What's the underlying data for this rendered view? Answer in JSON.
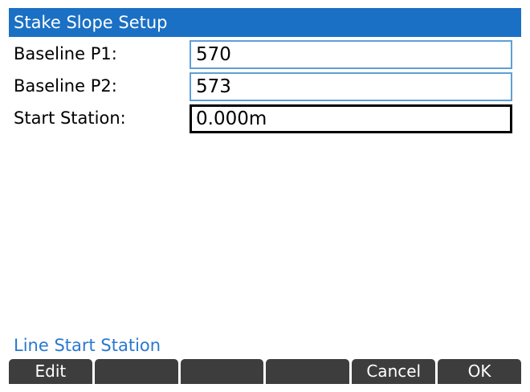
{
  "title": "Stake Slope Setup",
  "fields": [
    {
      "label": "Baseline P1:",
      "value": "570"
    },
    {
      "label": "Baseline P2:",
      "value": "573"
    },
    {
      "label": "Start Station:",
      "value": "0.000m"
    }
  ],
  "help_text": "Line Start Station",
  "softkeys": [
    "Edit",
    "",
    "",
    "",
    "Cancel",
    "OK"
  ],
  "colors": {
    "title_bar": "#1a70c4",
    "field_border": "#5e9fd8",
    "active_field_border": "#000000",
    "help_text": "#2a78cf",
    "softkey_bg": "#3d3d3d"
  }
}
